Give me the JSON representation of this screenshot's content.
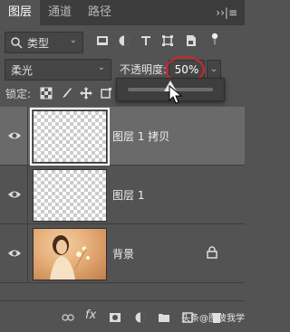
{
  "tabs": [
    {
      "label": "图层",
      "active": true
    },
    {
      "label": "通道",
      "active": false
    },
    {
      "label": "路径",
      "active": false
    }
  ],
  "panel_menu_label": "››|≡",
  "filter": {
    "kind_label": "类型",
    "icons": [
      "image-filter-icon",
      "adjustment-filter-icon",
      "type-filter-icon",
      "shape-filter-icon",
      "smart-object-filter-icon",
      "filter-toggle-icon"
    ]
  },
  "blend": {
    "mode": "柔光",
    "opacity_label": "不透明度:",
    "opacity_value": "50%",
    "opacity_fraction": 0.5
  },
  "lock": {
    "label": "锁定:",
    "icons": [
      "lock-transparent-pixels-icon",
      "lock-image-pixels-icon",
      "lock-position-icon",
      "lock-artboard-icon"
    ]
  },
  "layers": [
    {
      "name": "图层 1 拷贝",
      "visible": true,
      "selected": true,
      "type": "transparent"
    },
    {
      "name": "图层 1",
      "visible": true,
      "selected": false,
      "type": "transparent"
    },
    {
      "name": "背景",
      "visible": true,
      "selected": false,
      "type": "photo",
      "locked": true
    }
  ],
  "bottom_icons": [
    "link-layers-icon",
    "fx-icon",
    "add-mask-icon",
    "adjustment-layer-icon",
    "new-group-icon",
    "new-layer-icon",
    "delete-layer-icon"
  ],
  "bottom_fx_label": "fx",
  "watermark": "头条@图彼我学",
  "colors": {
    "panel_bg": "#535353",
    "tab_bar_bg": "#3c3c3c",
    "selected_row_bg": "#6a6a6a",
    "highlight_ring": "#d4242a"
  }
}
